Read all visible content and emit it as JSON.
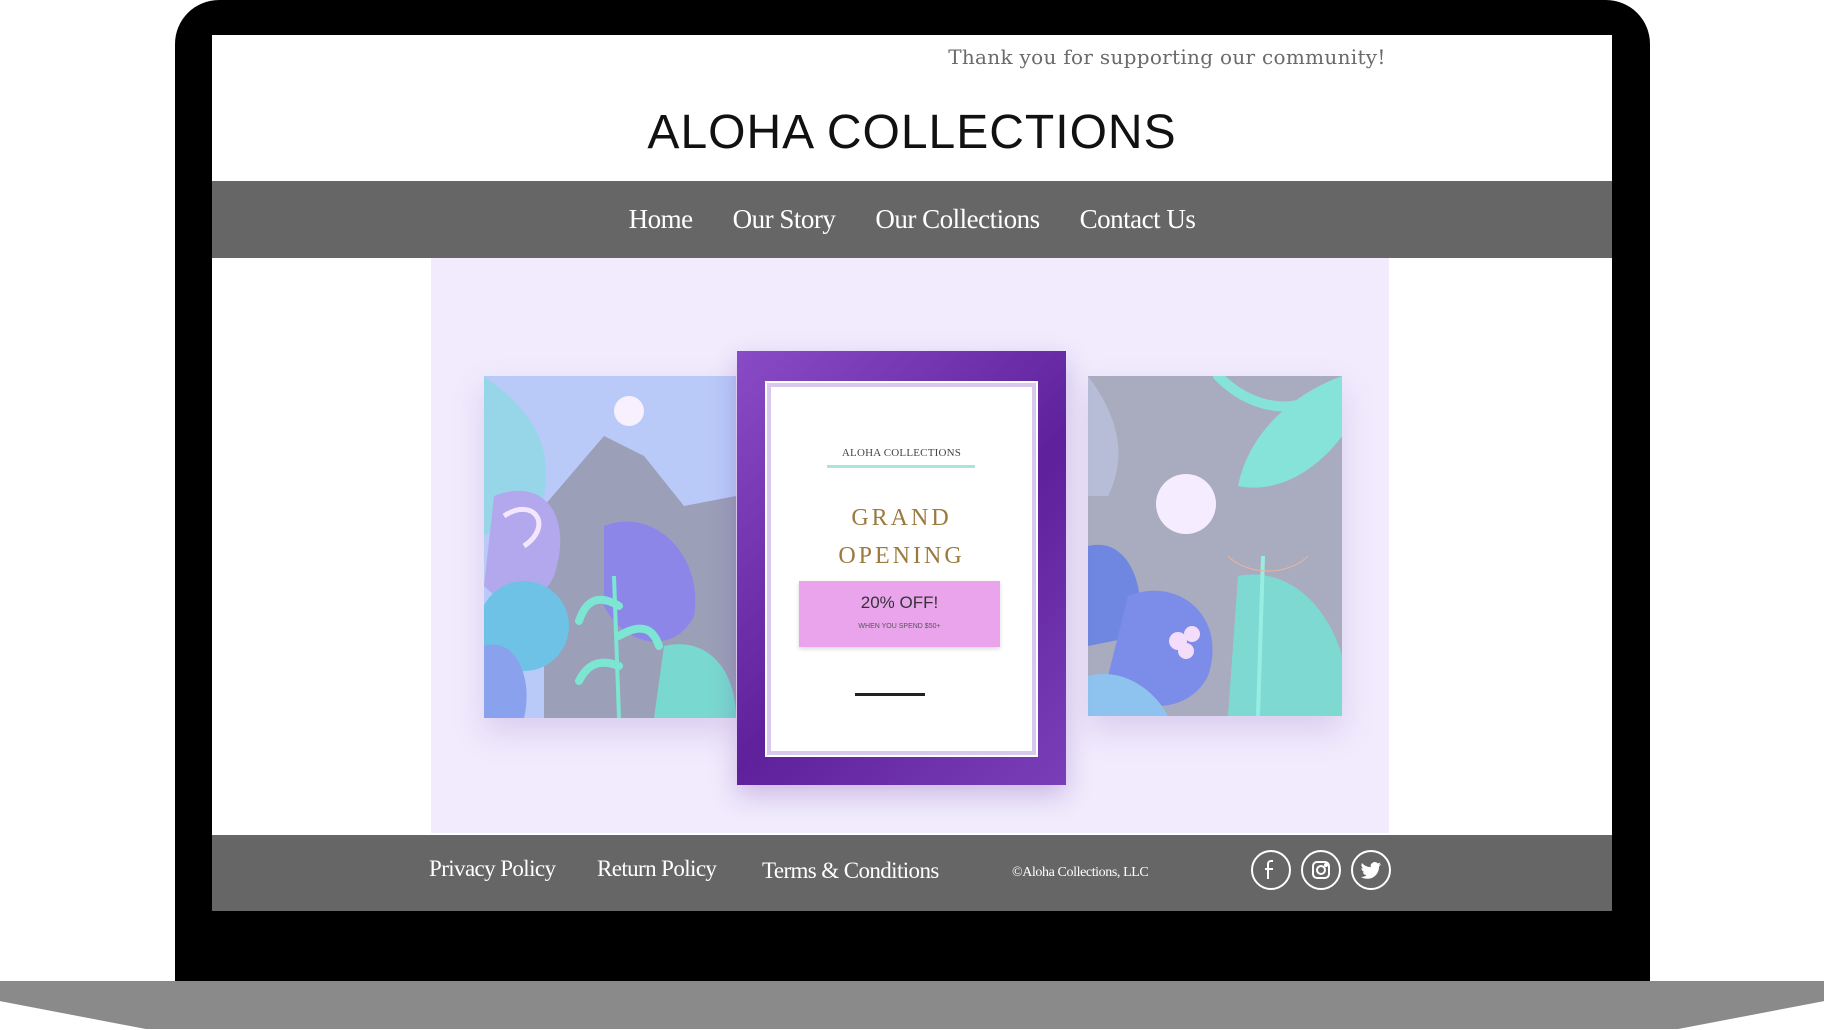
{
  "site": {
    "tagline": "Thank you for supporting our community!",
    "brand": "ALOHA COLLECTIONS"
  },
  "nav": {
    "items": [
      "Home",
      "Our Story",
      "Our Collections",
      "Contact Us"
    ]
  },
  "hero": {
    "poster": {
      "brand": "ALOHA COLLECTIONS",
      "title_line1": "GRAND",
      "title_line2": "OPENING",
      "promo_main": "20% OFF!",
      "promo_sub": "WHEN YOU SPEND $50+"
    },
    "colors": {
      "background": "#f1ebfd",
      "poster_frame": "#6a2ca8",
      "promo": "#e9a4ec",
      "accent_mint": "#a6e6dd"
    }
  },
  "footer": {
    "links": [
      "Privacy Policy",
      "Return Policy",
      "Terms & Conditions"
    ],
    "copyright": "©Aloha Collections, LLC",
    "social": [
      "facebook-icon",
      "instagram-icon",
      "twitter-icon"
    ]
  },
  "colors": {
    "nav_bg": "#666666",
    "frame": "#000000"
  }
}
